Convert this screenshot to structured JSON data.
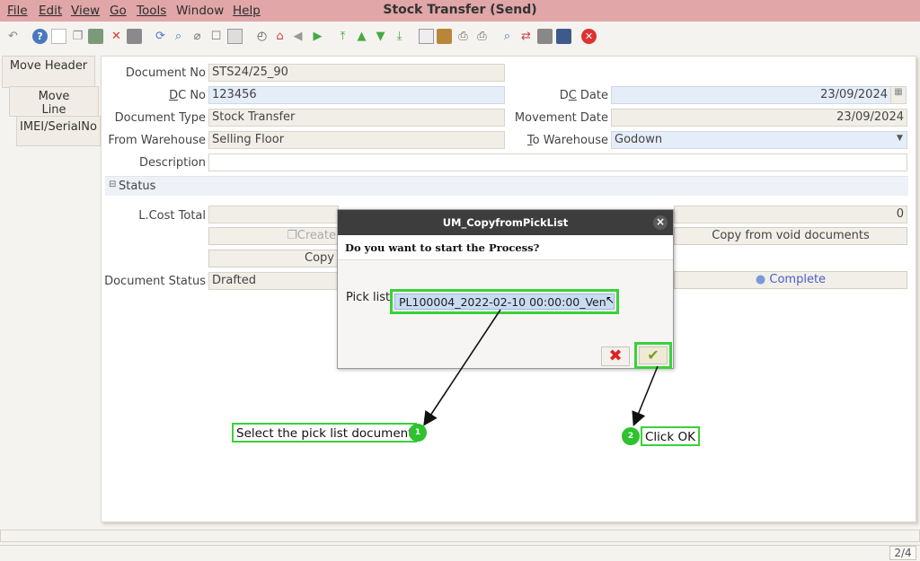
{
  "menu": [
    "File",
    "Edit",
    "View",
    "Go",
    "Tools",
    "Window",
    "Help"
  ],
  "window_title": "Stock Transfer (Send)",
  "tabs": [
    "Move Header",
    "Move Line",
    "IMEI/SerialNo"
  ],
  "form": {
    "document_no_label": "Document No",
    "document_no": "STS24/25_90",
    "dc_no_label": "DC No",
    "dc_no": "123456",
    "dc_date_label": "DC Date",
    "dc_date": "23/09/2024",
    "document_type_label": "Document Type",
    "document_type": "Stock Transfer",
    "movement_date_label": "Movement Date",
    "movement_date": "23/09/2024",
    "from_warehouse_label": "From Warehouse",
    "from_warehouse": "Selling Floor",
    "to_warehouse_label": "To Warehouse",
    "to_warehouse": "Godown",
    "description_label": "Description",
    "description": "",
    "status_section": "Status",
    "lcost_total_label": "L.Cost Total",
    "lcost_total": "",
    "right_total": "0",
    "create_button": "Create",
    "copy_button": "Copy",
    "copy_void_button": "Copy from void documents",
    "document_status_label": "Document Status",
    "document_status": "Drafted",
    "complete_button": "Complete"
  },
  "dialog": {
    "title": "UM_CopyfromPickList",
    "question": "Do you want to start the Process?",
    "pick_list_label": "Pick list",
    "pick_list_value": "PL100004_2022-02-10 00:00:00_Ven"
  },
  "annotations": {
    "step1_label": "Select the pick list document",
    "step1_number": "1",
    "step2_label": "Click OK",
    "step2_number": "2"
  },
  "pager": "2/4",
  "colors": {
    "menubar": "#e0a6a8",
    "highlight": "#3ad13a",
    "edit_field": "#e4edf8",
    "dialog_title": "#3d3d3d"
  }
}
